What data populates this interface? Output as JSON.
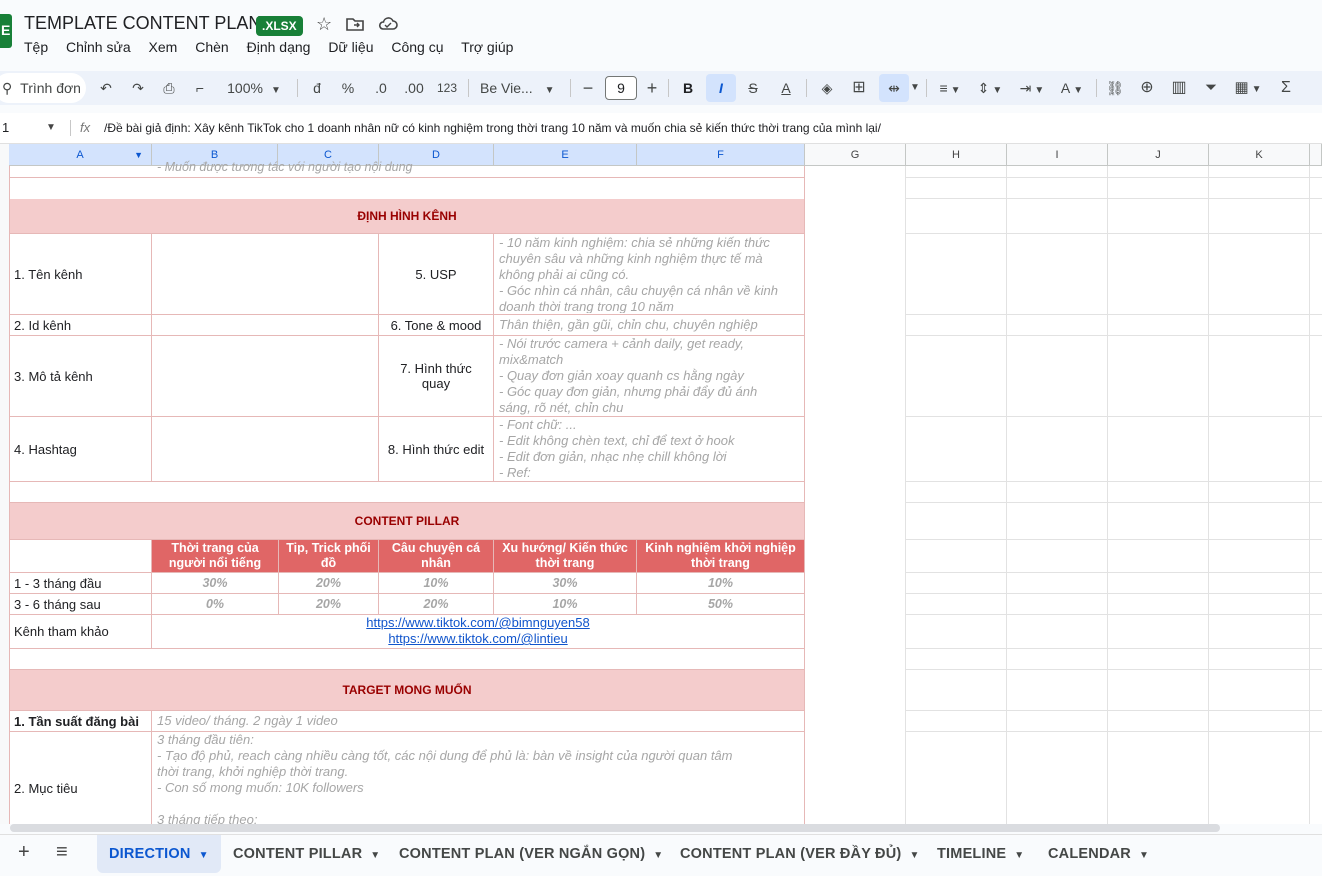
{
  "window": {
    "title": "TEMPLATE CONTENT PLAN",
    "badge": ".XLSX",
    "menus": [
      "Tệp",
      "Chỉnh sửa",
      "Xem",
      "Chèn",
      "Định dạng",
      "Dữ liệu",
      "Công cụ",
      "Trợ giúp"
    ]
  },
  "toolbar": {
    "search_label": "Trình đơn",
    "zoom": "100%",
    "currency": "đ",
    "percent": "%",
    "dec_decrease": ".0",
    "dec_increase": ".00",
    "number_format": "123",
    "font": "Be Vie...",
    "font_size": "9",
    "minus": "−",
    "plus": "+",
    "bold": "B",
    "italic": "I",
    "strike": "S",
    "textcolor": "A",
    "sigma": "Σ"
  },
  "formula_bar": {
    "cell_ref": "1",
    "fx": "fx",
    "content": "/Đề bài giả định: Xây kênh TikTok cho 1 doanh nhân nữ có kinh nghiệm trong thời trang 10 năm và muốn chia sẻ kiến thức thời trang của mình lại/"
  },
  "columns": [
    "A",
    "B",
    "C",
    "D",
    "E",
    "F",
    "G",
    "H",
    "I",
    "J",
    "K"
  ],
  "sheet": {
    "top_cut_text": "- Muốn được tương tác với người tạo nội dung",
    "dinh_hinh": {
      "header": "ĐỊNH HÌNH KÊNH",
      "rows": [
        {
          "label": "1. Tên kênh",
          "right_label": "5. USP",
          "lines": [
            "- 10 năm kinh nghiệm: chia sẻ những kiến thức",
            "chuyên sâu và những kinh nghiệm thực tế mà",
            "không phải ai cũng có.",
            "- Góc nhìn cá nhân, câu chuyện cá nhân về kinh",
            "doanh thời trang trong 10 năm"
          ]
        },
        {
          "label": "2. Id kênh",
          "right_label": "6. Tone & mood",
          "lines": [
            "Thân thiện, gần gũi, chỉn chu, chuyên nghiệp"
          ]
        },
        {
          "label": "3. Mô tả kênh",
          "right_label": "7. Hình thức quay",
          "lines": [
            "- Nói trước camera + cảnh daily, get ready,",
            "mix&match",
            "- Quay đơn giản xoay quanh cs hằng ngày",
            "- Góc quay đơn giản, nhưng phải đẩy đủ ánh",
            "sáng, rõ nét, chỉn chu"
          ]
        },
        {
          "label": "4. Hashtag",
          "right_label": "8. Hình thức edit",
          "lines": [
            "- Font chữ: ...",
            "- Edit không chèn text, chỉ để text ở hook",
            "- Edit đơn giản, nhạc nhẹ chill không lời",
            "- Ref:"
          ]
        }
      ]
    },
    "content_pillar": {
      "header": "CONTENT PILLAR",
      "columns": [
        "Thời trang của người nổi tiếng",
        "Tip, Trick phối đồ",
        "Câu chuyện cá nhân",
        "Xu hướng/ Kiến thức thời trang",
        "Kinh nghiệm khởi nghiệp thời trang"
      ],
      "rows": [
        {
          "label": "1 - 3 tháng đầu",
          "values": [
            "30%",
            "20%",
            "10%",
            "30%",
            "10%"
          ]
        },
        {
          "label": "3 - 6 tháng sau",
          "values": [
            "0%",
            "20%",
            "20%",
            "10%",
            "50%"
          ]
        }
      ],
      "ref_label": "Kênh tham khảo",
      "links": [
        "https://www.tiktok.com/@bimnguyen58",
        "https://www.tiktok.com/@lintieu"
      ]
    },
    "target": {
      "header": "TARGET MONG MUỐN",
      "freq_label": "1. Tần suất đăng bài",
      "freq_value": "15 video/ tháng. 2 ngày 1 video",
      "goal_label": "2. Mục tiêu",
      "goal_lines": [
        "3 tháng đầu tiên:",
        "- Tạo độ phủ, reach càng nhiều càng tốt, các nội dung để phủ là: bàn về insight của người quan tâm",
        "thời trang, khởi nghiệp thời trang.",
        "- Con số mong muốn: 10K followers",
        "",
        "3 tháng tiếp theo:"
      ]
    }
  },
  "tabs": [
    "DIRECTION",
    "CONTENT PILLAR",
    "CONTENT PLAN (VER NGẮN GỌN)",
    "CONTENT PLAN (VER ĐẦY ĐỦ)",
    "TIMELINE",
    "CALENDAR"
  ]
}
